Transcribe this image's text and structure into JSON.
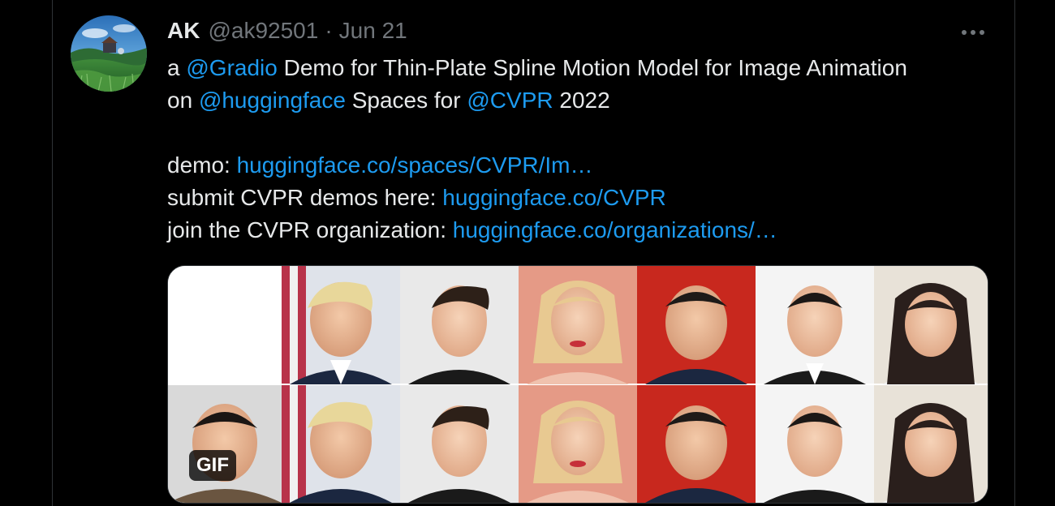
{
  "tweet": {
    "display_name": "AK",
    "handle": "@ak92501",
    "separator": "·",
    "date": "Jun 21",
    "text": {
      "line1": {
        "w1": "a",
        "mention_gradio": "@Gradio",
        "rest": "Demo for Thin-Plate Spline Motion Model for Image Animation"
      },
      "line2": {
        "w1": "on",
        "mention_huggingface": "@huggingface",
        "mid": "Spaces for",
        "mention_cvpr": "@CVPR",
        "year": "2022"
      },
      "line3": {
        "label": "demo:",
        "link": "huggingface.co/spaces/CVPR/Im…"
      },
      "line4": {
        "label": "submit CVPR demos here:",
        "link": "huggingface.co/CVPR"
      },
      "line5": {
        "label": "join the CVPR organization:",
        "link": "huggingface.co/organizations/…"
      }
    },
    "media": {
      "badge": "GIF"
    }
  },
  "icons": {
    "more": "more-horizontal-icon",
    "avatar": "avatar-landscape"
  },
  "colors": {
    "background": "#000000",
    "text": "#e7e9ea",
    "secondary_text": "#71767b",
    "link": "#1d9bf0",
    "border": "#2f3336"
  }
}
